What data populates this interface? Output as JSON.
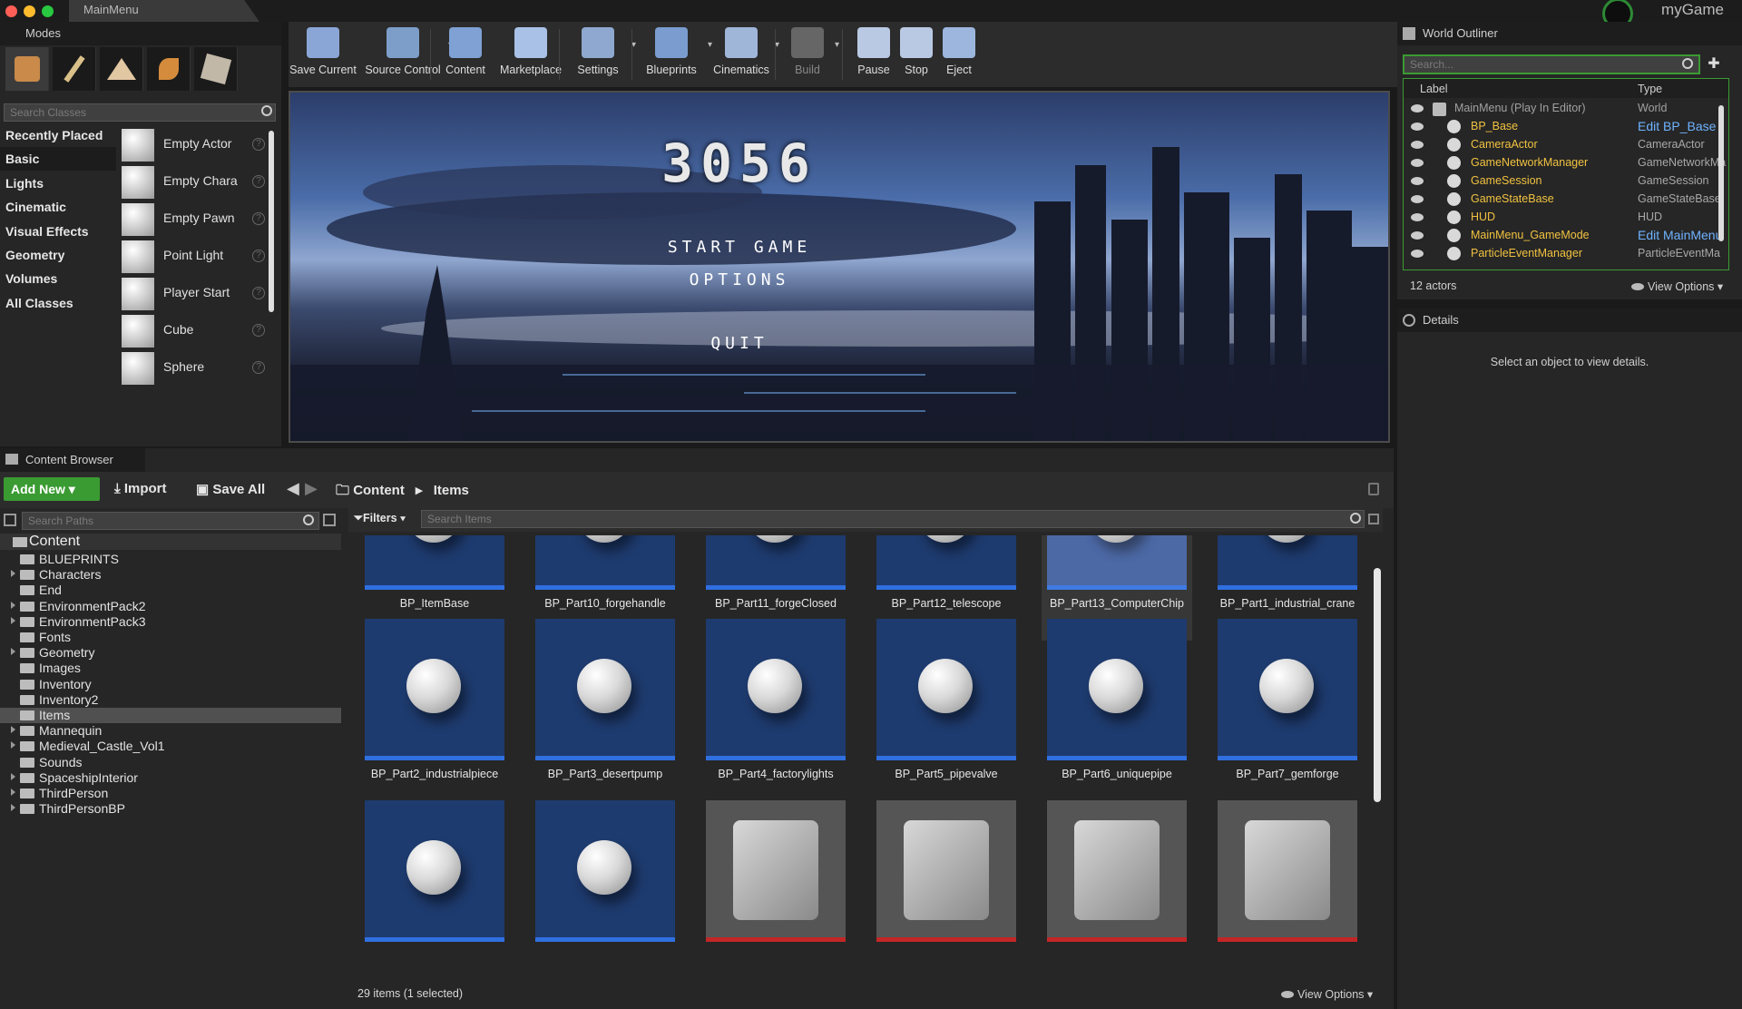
{
  "titlebar": {
    "tab": "MainMenu",
    "project": "myGame"
  },
  "modes": {
    "title": "Modes",
    "search_placeholder": "Search Classes",
    "categories": [
      "Recently Placed",
      "Basic",
      "Lights",
      "Cinematic",
      "Visual Effects",
      "Geometry",
      "Volumes",
      "All Classes"
    ],
    "active_category": "Basic",
    "placeables": [
      "Empty Actor",
      "Empty Chara",
      "Empty Pawn",
      "Point Light",
      "Player Start",
      "Cube",
      "Sphere"
    ]
  },
  "toolbar": {
    "buttons": [
      "Save Current",
      "Source Control",
      "Content",
      "Marketplace",
      "Settings",
      "Blueprints",
      "Cinematics",
      "Build",
      "Pause",
      "Stop",
      "Eject"
    ]
  },
  "viewport": {
    "game_title": "3056",
    "menu": [
      "START GAME",
      "OPTIONS",
      "QUIT"
    ]
  },
  "outliner": {
    "title": "World Outliner",
    "search_placeholder": "Search...",
    "col_label": "Label",
    "col_type": "Type",
    "root": {
      "name": "MainMenu (Play In Editor)",
      "type": "World"
    },
    "rows": [
      {
        "name": "BP_Base",
        "type": "Edit BP_Base",
        "link": true
      },
      {
        "name": "CameraActor",
        "type": "CameraActor",
        "link": false
      },
      {
        "name": "GameNetworkManager",
        "type": "GameNetworkMa",
        "link": false
      },
      {
        "name": "GameSession",
        "type": "GameSession",
        "link": false
      },
      {
        "name": "GameStateBase",
        "type": "GameStateBase",
        "link": false
      },
      {
        "name": "HUD",
        "type": "HUD",
        "link": false
      },
      {
        "name": "MainMenu_GameMode",
        "type": "Edit MainMenu",
        "link": true
      },
      {
        "name": "ParticleEventManager",
        "type": "ParticleEventMa",
        "link": false
      }
    ],
    "count": "12 actors",
    "view_options": "View Options"
  },
  "details": {
    "title": "Details",
    "empty_text": "Select an object to view details."
  },
  "content_browser": {
    "title": "Content Browser",
    "add_new": "Add New",
    "import": "Import",
    "save_all": "Save All",
    "path": [
      "Content",
      "Items"
    ],
    "search_paths_placeholder": "Search Paths",
    "filters": "Filters",
    "search_items_placeholder": "Search Items",
    "tree_root": "Content",
    "folders": [
      {
        "name": "BLUEPRINTS",
        "expandable": false
      },
      {
        "name": "Characters",
        "expandable": true
      },
      {
        "name": "End",
        "expandable": false
      },
      {
        "name": "EnvironmentPack2",
        "expandable": true
      },
      {
        "name": "EnvironmentPack3",
        "expandable": true
      },
      {
        "name": "Fonts",
        "expandable": false
      },
      {
        "name": "Geometry",
        "expandable": true
      },
      {
        "name": "Images",
        "expandable": false
      },
      {
        "name": "Inventory",
        "expandable": false
      },
      {
        "name": "Inventory2",
        "expandable": false
      },
      {
        "name": "Items",
        "expandable": false
      },
      {
        "name": "Mannequin",
        "expandable": true
      },
      {
        "name": "Medieval_Castle_Vol1",
        "expandable": true
      },
      {
        "name": "Sounds",
        "expandable": false
      },
      {
        "name": "SpaceshipInterior",
        "expandable": true
      },
      {
        "name": "ThirdPerson",
        "expandable": true
      },
      {
        "name": "ThirdPersonBP",
        "expandable": true
      }
    ],
    "selected_folder": "Items",
    "assets_row1": [
      "BP_ItemBase",
      "BP_Part10_forgehandle",
      "BP_Part11_forgeClosed",
      "BP_Part12_telescope",
      "BP_Part13_ComputerChip",
      "BP_Part1_industrial_crane"
    ],
    "assets_row2": [
      "BP_Part2_industrialpiece",
      "BP_Part3_desertpump",
      "BP_Part4_factorylights",
      "BP_Part5_pipevalve",
      "BP_Part6_uniquepipe",
      "BP_Part7_gemforge"
    ],
    "assets_row3_count": 6,
    "assets_row3_textured": [
      false,
      false,
      true,
      true,
      true,
      true
    ],
    "selected_asset": "BP_Part13_ComputerChip",
    "status": "29 items (1 selected)",
    "view_options": "View Options"
  },
  "colors": {
    "accent_green": "#3a9b32",
    "selection_blue": "#2f6fe0",
    "outliner_name": "#f1c240",
    "link_blue": "#6fb3ff"
  }
}
